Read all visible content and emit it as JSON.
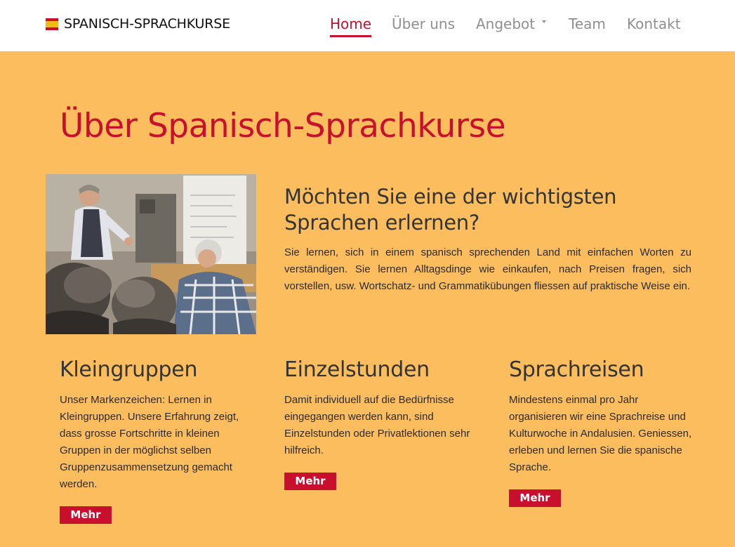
{
  "brand": {
    "name": "SPANISCH-SPRACHKURSE",
    "flag_colors": [
      "#c8102e",
      "#f3b81a",
      "#c8102e"
    ]
  },
  "nav": {
    "items": [
      {
        "label": "Home",
        "active": true
      },
      {
        "label": "Über uns",
        "active": false
      },
      {
        "label": "Angebot",
        "active": false,
        "dropdown": true
      },
      {
        "label": "Team",
        "active": false
      },
      {
        "label": "Kontakt",
        "active": false
      }
    ]
  },
  "page": {
    "title": "Über Spanisch-Sprachkurse"
  },
  "intro": {
    "heading": "Möchten Sie eine der wichtigsten Sprachen erlernen?",
    "text": "Sie lernen, sich in einem spanisch sprechenden Land mit einfachen Worten zu verständigen. Sie lernen Alltagsdinge wie einkaufen, nach Preisen fragen, sich vorstellen, usw. Wortschatz- und Grammatikübungen fliessen auf praktische Weise ein."
  },
  "features": [
    {
      "title": "Kleingruppen",
      "text": "Unser Markenzeichen: Lernen in Kleingruppen. Unsere Erfahrung zeigt, dass grosse Fortschritte in kleinen Gruppen in der möglichst selben Gruppenzusammensetzung gemacht werden.",
      "button": "Mehr"
    },
    {
      "title": "Einzelstunden",
      "text": "Damit individuell auf die Bedürfnisse eingegangen werden kann, sind Einzelstunden oder Privatlektionen sehr hilfreich.",
      "button": "Mehr"
    },
    {
      "title": "Sprachreisen",
      "text": "Mindestens einmal pro Jahr organisieren wir eine Sprachreise und Kulturwoche in Andalusien. Geniessen, erleben und lernen Sie die spanische Sprache.",
      "button": "Mehr"
    }
  ],
  "colors": {
    "accent": "#c8102e",
    "background": "#fbbd5e",
    "navbar": "#ffffff",
    "muted_nav": "#8f8f8f"
  }
}
